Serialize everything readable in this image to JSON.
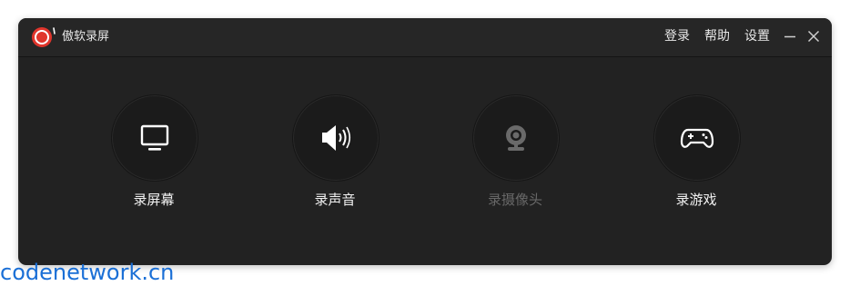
{
  "app": {
    "title": "傲软录屏",
    "logo_icon": "record-dot-logo-icon",
    "accent_color": "#e0352c"
  },
  "titlebar": {
    "login_label": "登录",
    "help_label": "帮助",
    "settings_label": "设置",
    "minimize_icon": "minimize-icon",
    "close_icon": "close-icon"
  },
  "features": [
    {
      "label": "录屏幕",
      "icon": "monitor-icon",
      "enabled": true
    },
    {
      "label": "录声音",
      "icon": "speaker-icon",
      "enabled": true
    },
    {
      "label": "录摄像头",
      "icon": "webcam-icon",
      "enabled": false
    },
    {
      "label": "录游戏",
      "icon": "gamepad-icon",
      "enabled": true
    }
  ],
  "watermark": {
    "text": "codenetwork.cn",
    "color": "#1a6fd6"
  }
}
